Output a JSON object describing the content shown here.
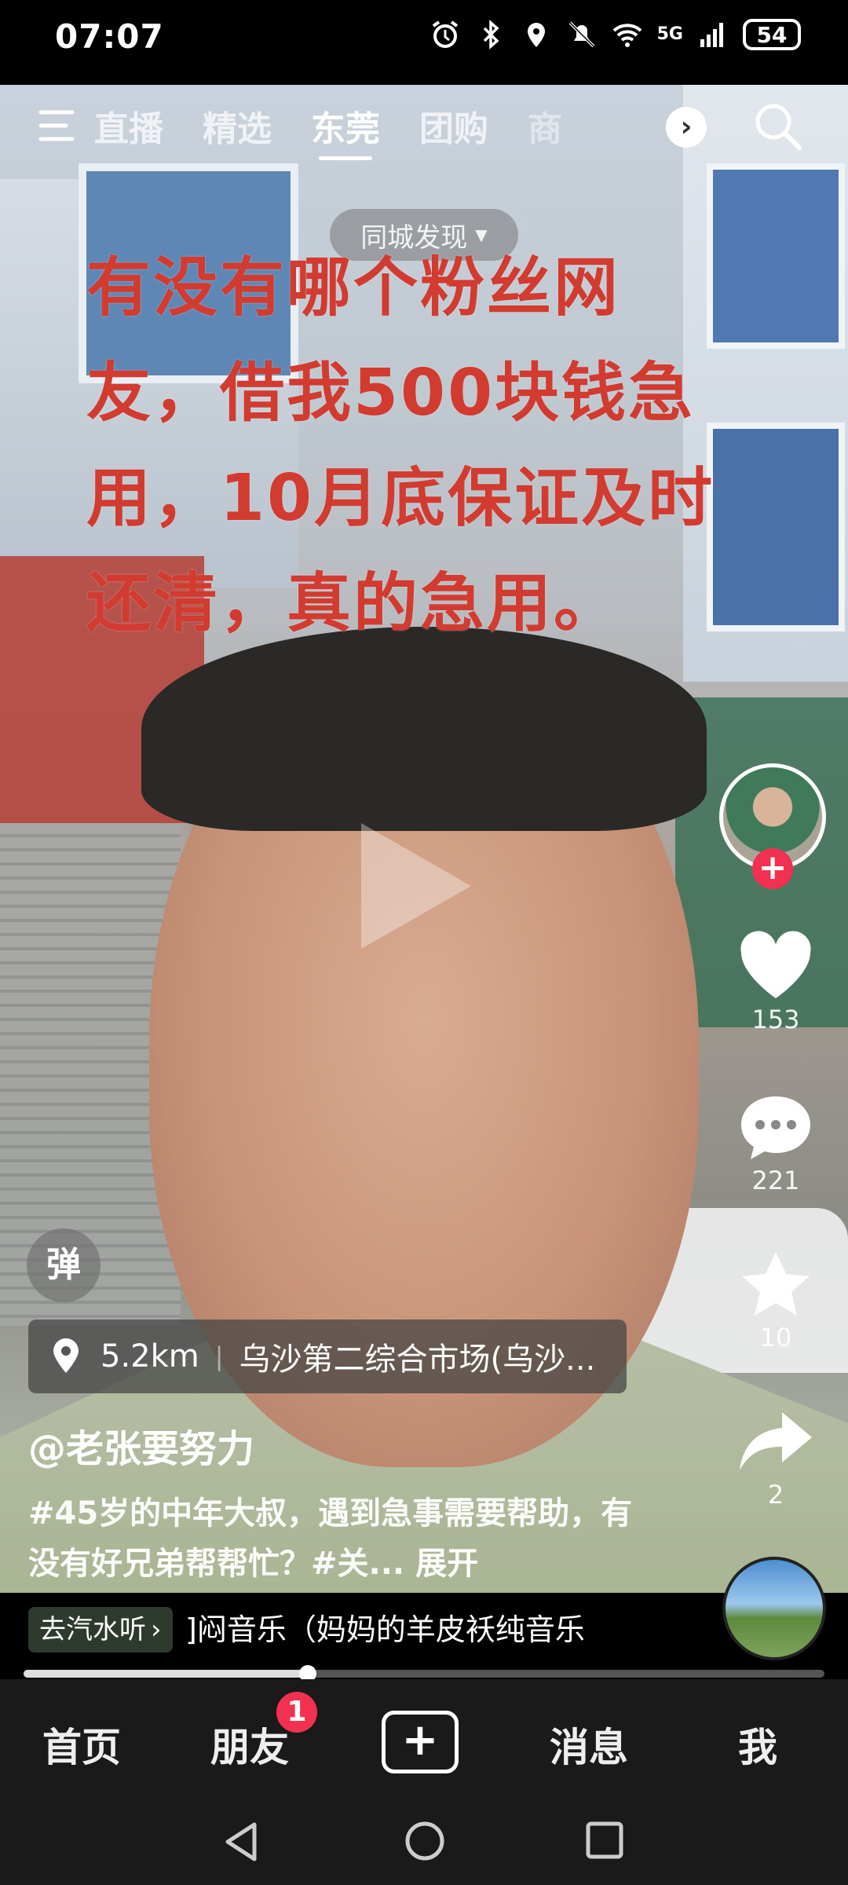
{
  "status_bar": {
    "time": "07:07",
    "network": "5G",
    "battery": "54",
    "icons": [
      "alarm-icon",
      "bluetooth-icon",
      "location-icon",
      "mute-icon",
      "wifi-icon",
      "signal-icon"
    ]
  },
  "top_nav": {
    "tabs": [
      {
        "label": "直播",
        "active": false
      },
      {
        "label": "精选",
        "active": false
      },
      {
        "label": "东莞",
        "active": true
      },
      {
        "label": "团购",
        "active": false
      },
      {
        "label": "商",
        "active": false
      }
    ],
    "city_discover": "同城发现"
  },
  "video": {
    "overlay_text": "有没有哪个粉丝网友，借我500块钱急用，10月底保证及时还清，真的急用。"
  },
  "danmu_label": "弹",
  "actions": {
    "likes": "153",
    "comments": "221",
    "favorites": "10",
    "shares": "2"
  },
  "location": {
    "distance": "5.2km",
    "name": "乌沙第二综合市场(乌沙..."
  },
  "post": {
    "username": "@老张要努力",
    "description": "#45岁的中年大叔，遇到急事需要帮助，有没有好兄弟帮帮忙？#关...",
    "expand_label": "展开"
  },
  "music": {
    "button_label": "去汽水听",
    "track": "]闷音乐（妈妈的羊皮袄纯音乐"
  },
  "progress": {
    "fraction": 0.355
  },
  "bottom_nav": {
    "home": "首页",
    "friends": "朋友",
    "friends_badge": "1",
    "add": "+",
    "messages": "消息",
    "me": "我"
  },
  "colors": {
    "accent": "#f1314f",
    "overlay_text": "#d23b2f"
  }
}
